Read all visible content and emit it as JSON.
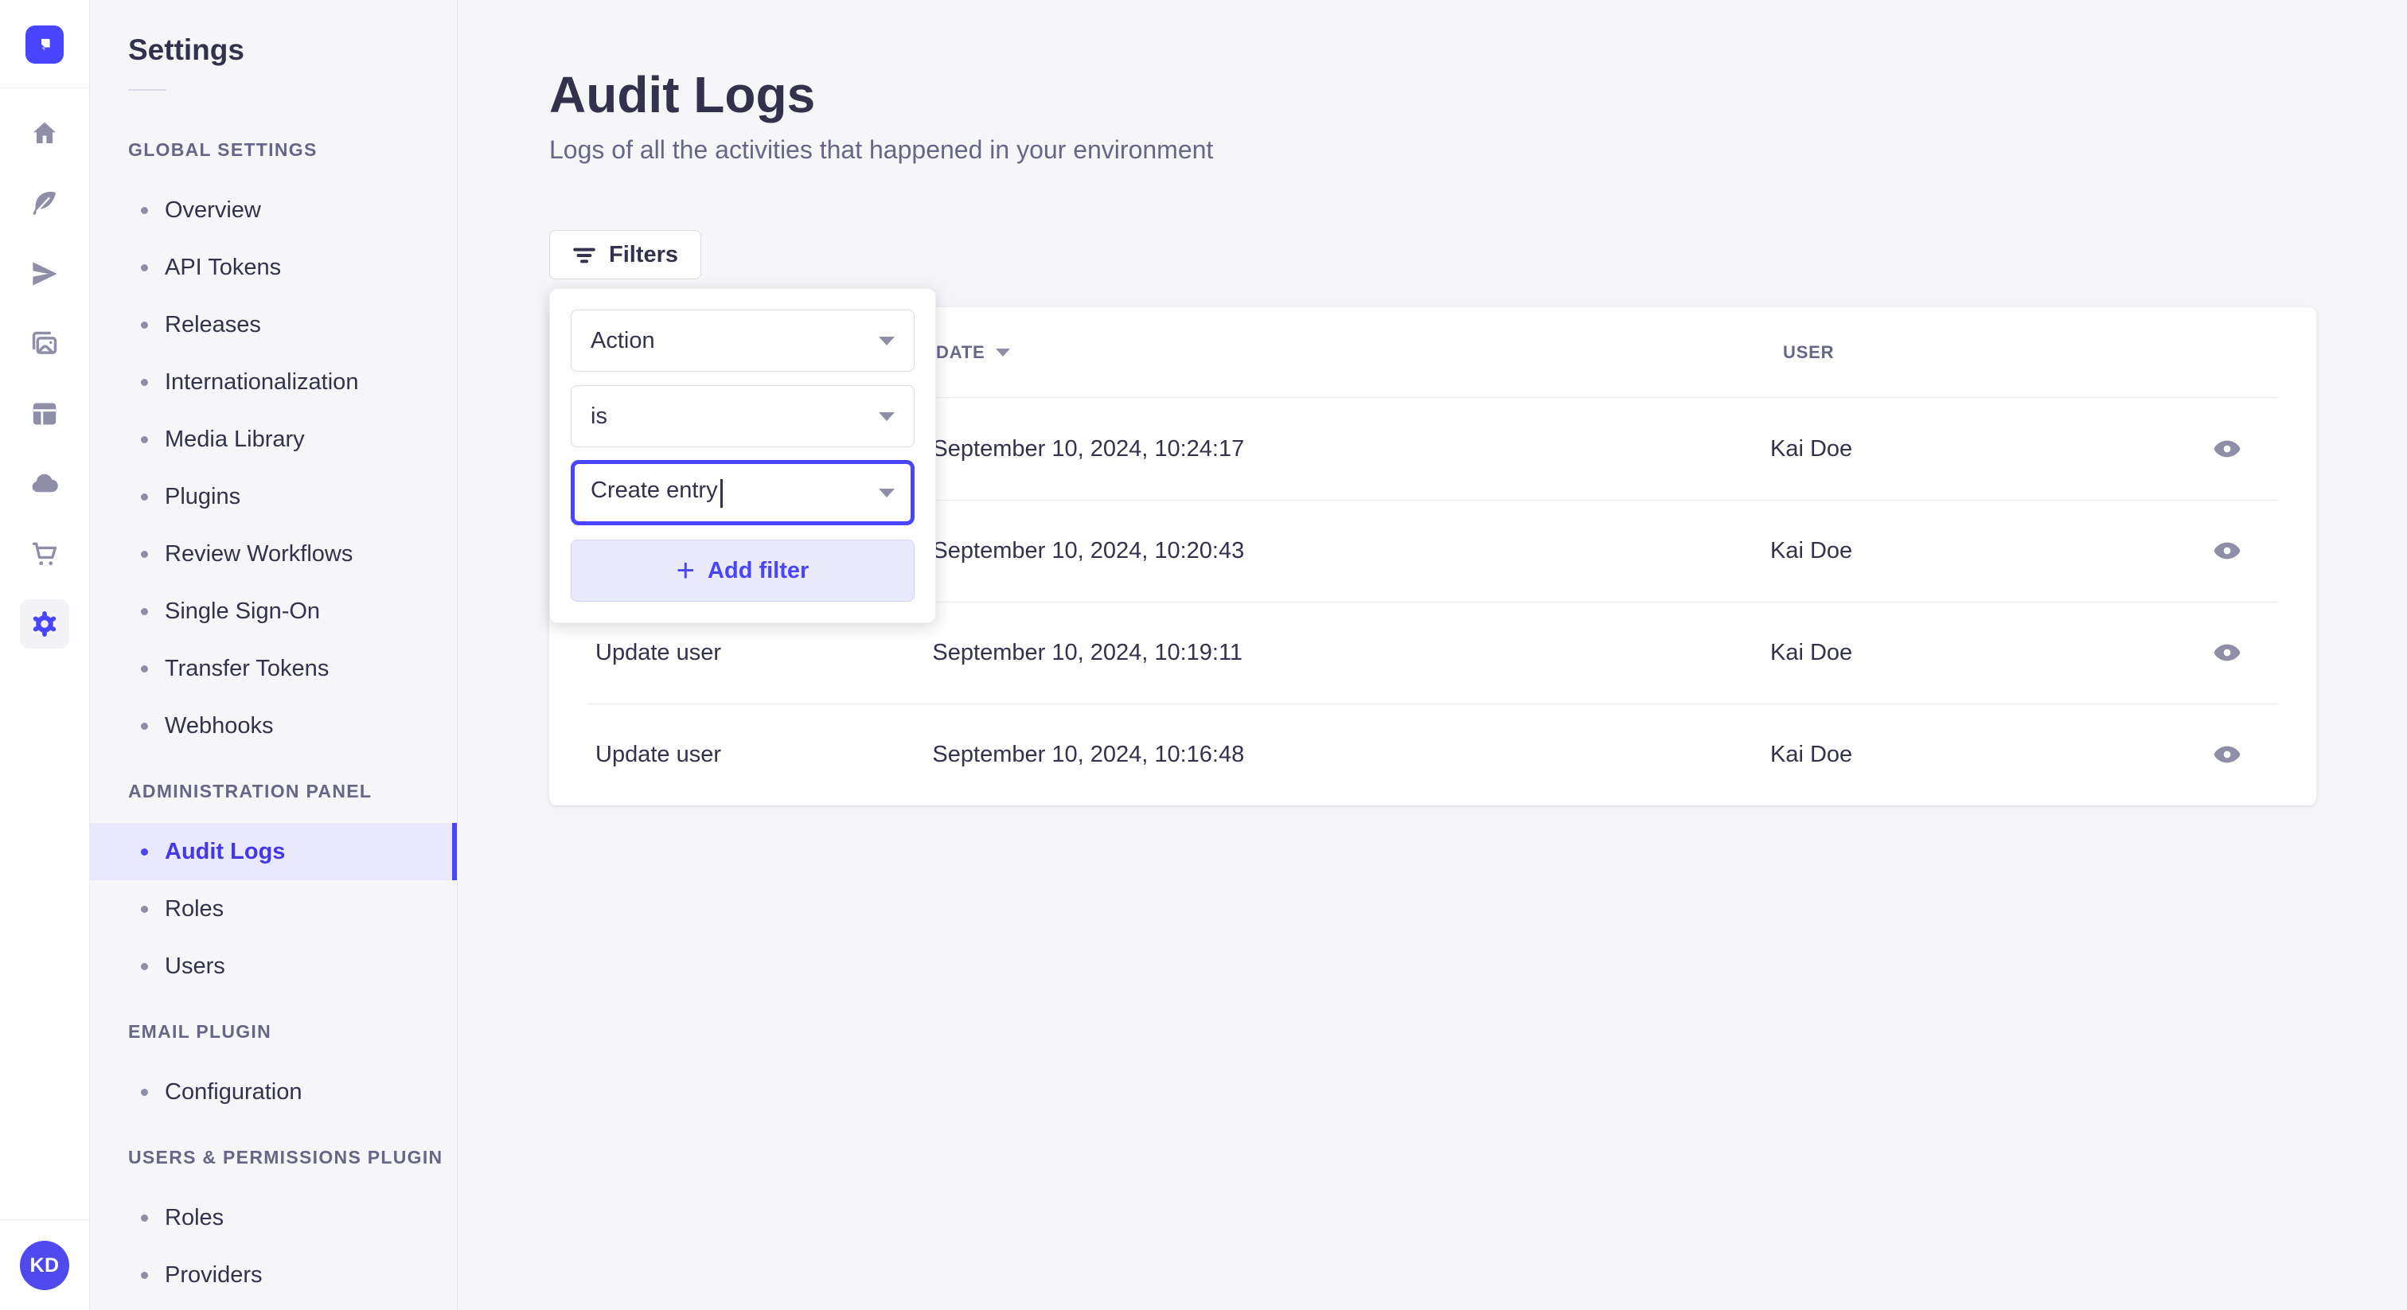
{
  "colors": {
    "accent": "#4945ff",
    "accent_text_active": "#4338e8",
    "accent_soft_bg": "#e9e8fd",
    "add_filter_bg": "#eaeafd",
    "text": "#32324d",
    "muted_text": "#666687",
    "icon_grey": "#8e8ea9",
    "border": "#dcdce4",
    "page_bg": "#f6f6f9"
  },
  "icon_bar": {
    "logo": "strapi-logo",
    "icons": [
      "home-icon",
      "feather-icon",
      "paper-plane-icon",
      "media-library-icon",
      "layout-icon",
      "cloud-icon",
      "cart-icon",
      "gear-icon"
    ],
    "active_icon": "gear-icon",
    "avatar_initials": "KD"
  },
  "settings_nav": {
    "title": "Settings",
    "sections": [
      {
        "label": "GLOBAL SETTINGS",
        "items": [
          {
            "label": "Overview"
          },
          {
            "label": "API Tokens"
          },
          {
            "label": "Releases"
          },
          {
            "label": "Internationalization"
          },
          {
            "label": "Media Library"
          },
          {
            "label": "Plugins"
          },
          {
            "label": "Review Workflows"
          },
          {
            "label": "Single Sign-On"
          },
          {
            "label": "Transfer Tokens"
          },
          {
            "label": "Webhooks"
          }
        ]
      },
      {
        "label": "ADMINISTRATION PANEL",
        "items": [
          {
            "label": "Audit Logs",
            "active": true
          },
          {
            "label": "Roles"
          },
          {
            "label": "Users"
          }
        ]
      },
      {
        "label": "EMAIL PLUGIN",
        "items": [
          {
            "label": "Configuration"
          }
        ]
      },
      {
        "label": "USERS & PERMISSIONS PLUGIN",
        "items": [
          {
            "label": "Roles"
          },
          {
            "label": "Providers"
          }
        ]
      }
    ]
  },
  "page": {
    "title": "Audit Logs",
    "subtitle": "Logs of all the activities that happened in your environment",
    "filters_button": "Filters"
  },
  "filter_popover": {
    "field_value": "Action",
    "operator_value": "is",
    "action_value": "Create entry",
    "add_filter_label": "Add filter"
  },
  "table": {
    "headers": {
      "date": "DATE",
      "user": "USER"
    },
    "rows": [
      {
        "action": "",
        "date": "September 10, 2024, 10:24:17",
        "user": "Kai Doe"
      },
      {
        "action": "",
        "date": "September 10, 2024, 10:20:43",
        "user": "Kai Doe"
      },
      {
        "action": "Update user",
        "date": "September 10, 2024, 10:19:11",
        "user": "Kai Doe"
      },
      {
        "action": "Update user",
        "date": "September 10, 2024, 10:16:48",
        "user": "Kai Doe"
      }
    ]
  },
  "help_button": {
    "icon": "question-icon"
  }
}
